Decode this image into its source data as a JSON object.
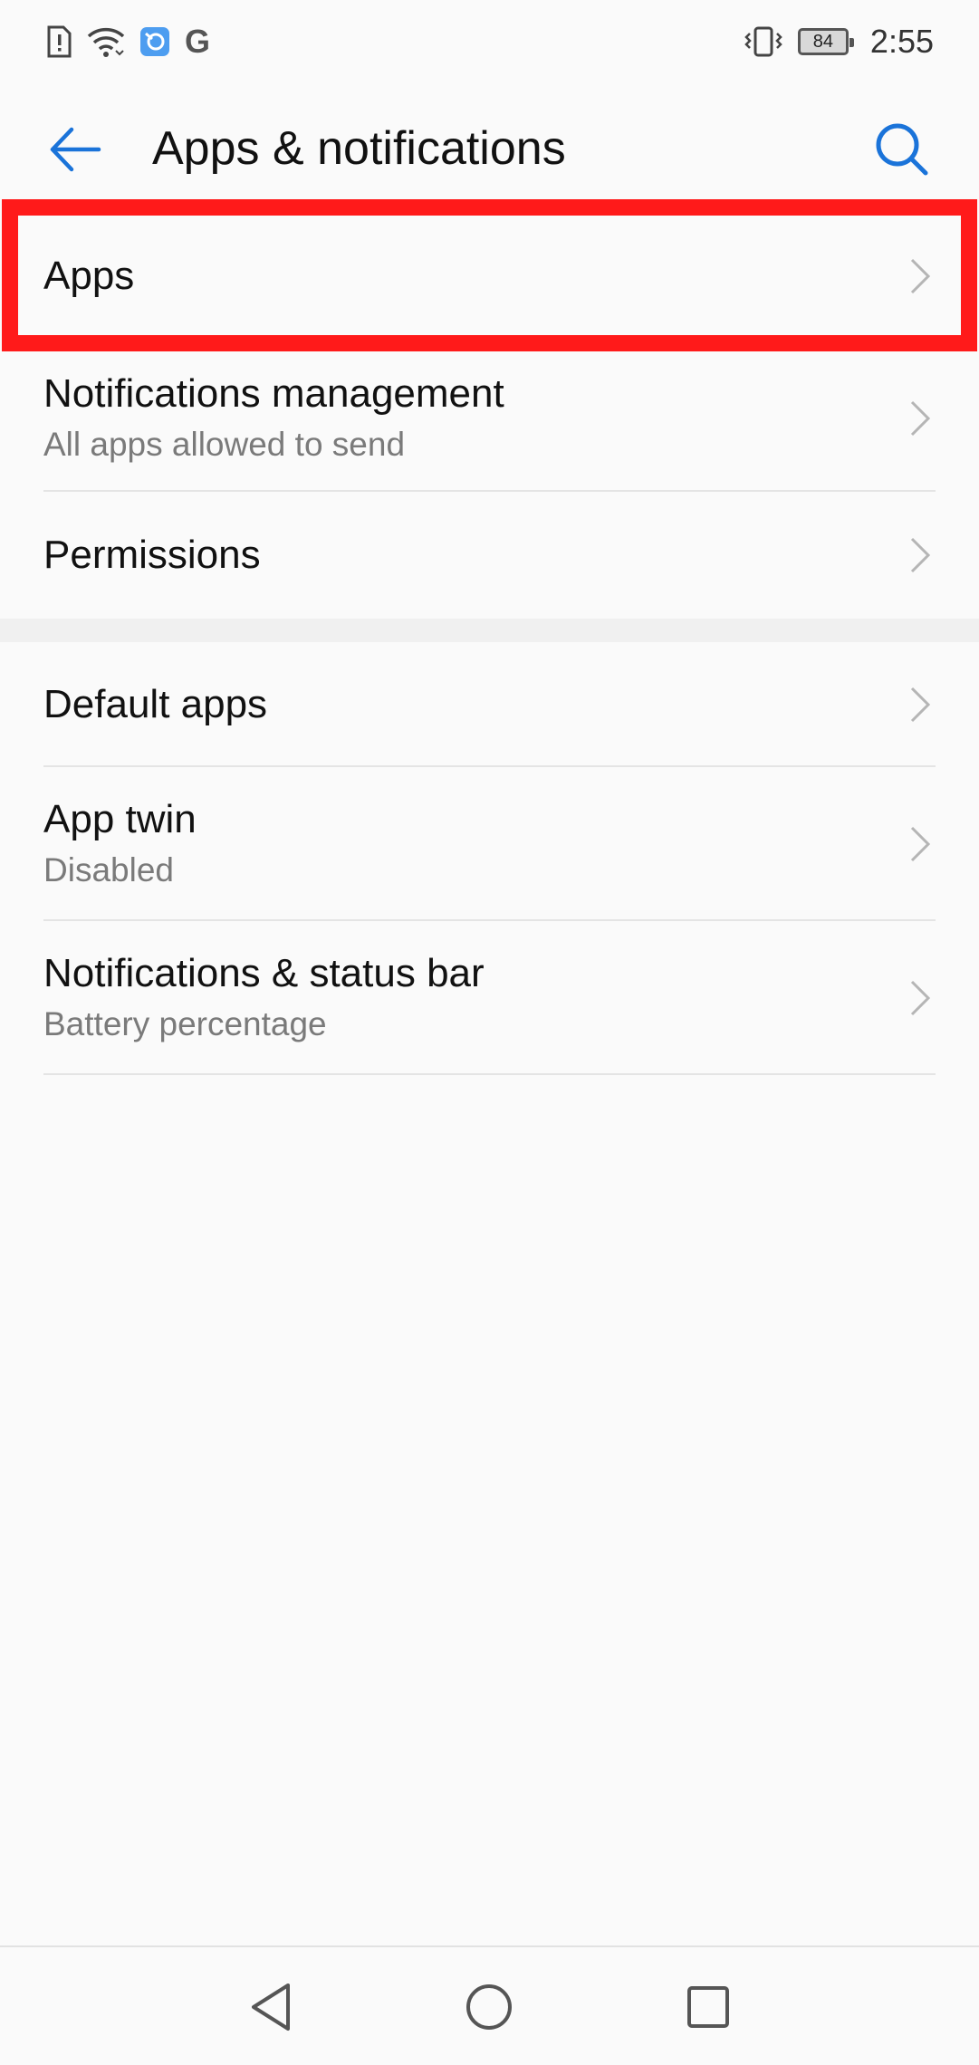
{
  "status_bar": {
    "time": "2:55",
    "battery": "84",
    "icons": [
      "sim-alert-icon",
      "wifi-icon",
      "app-notification-icon",
      "google-icon",
      "vibrate-icon",
      "battery-icon"
    ],
    "google_letter": "G"
  },
  "app_bar": {
    "title": "Apps & notifications",
    "back_icon": "arrow-left-icon",
    "search_icon": "search-icon",
    "accent": "#1a73d9"
  },
  "items": [
    {
      "title": "Apps",
      "subtitle": ""
    },
    {
      "title": "Notifications management",
      "subtitle": "All apps allowed to send"
    },
    {
      "title": "Permissions",
      "subtitle": ""
    },
    {
      "title": "Default apps",
      "subtitle": ""
    },
    {
      "title": "App twin",
      "subtitle": "Disabled"
    },
    {
      "title": "Notifications & status bar",
      "subtitle": "Battery percentage"
    }
  ],
  "highlight": {
    "color": "#ff1a1a",
    "target": "Apps"
  },
  "nav_bar": {
    "back_icon": "triangle-back-icon",
    "home_icon": "circle-home-icon",
    "recents_icon": "square-recents-icon"
  }
}
